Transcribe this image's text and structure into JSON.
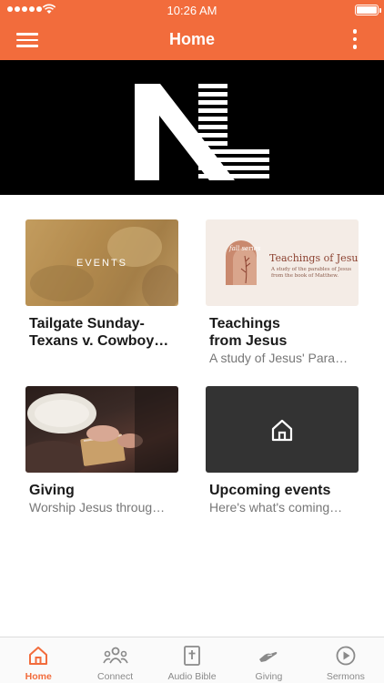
{
  "status_bar": {
    "time": "10:26 AM"
  },
  "header": {
    "title": "Home"
  },
  "banner": {
    "logo_letters": "NL"
  },
  "cards": [
    {
      "title": "Tailgate Sunday-\nTexans v. Cowboy…",
      "subtitle": "",
      "thumb_label": "EVENTS"
    },
    {
      "title": "Teachings\nfrom Jesus",
      "subtitle": "A study of Jesus' Para…",
      "thumb_series": "fall series",
      "thumb_title": "Teachings of Jesus",
      "thumb_desc": "A study of the parables of Jesus\nfrom the book of Matthew."
    },
    {
      "title": "Giving",
      "subtitle": "Worship Jesus throug…"
    },
    {
      "title": "Upcoming events",
      "subtitle": "Here's what's coming…"
    }
  ],
  "tabs": [
    {
      "label": "Home",
      "icon": "home-icon",
      "active": true
    },
    {
      "label": "Connect",
      "icon": "people-icon",
      "active": false
    },
    {
      "label": "Audio Bible",
      "icon": "bible-icon",
      "active": false
    },
    {
      "label": "Giving",
      "icon": "giving-hand-icon",
      "active": false
    },
    {
      "label": "Sermons",
      "icon": "play-circle-icon",
      "active": false
    }
  ],
  "colors": {
    "accent": "#f26c3c",
    "banner": "#000000",
    "tile_dark": "#333333",
    "inactive": "#8a8a8a"
  }
}
